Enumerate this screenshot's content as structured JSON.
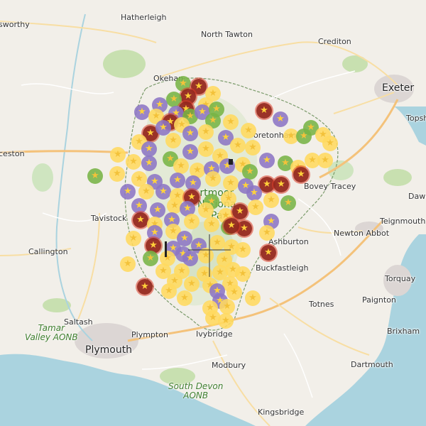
{
  "map": {
    "towns": [
      {
        "id": "holsworthy",
        "label": "sworthy",
        "size": "small"
      },
      {
        "id": "hatherleigh",
        "label": "Hatherleigh",
        "size": "small"
      },
      {
        "id": "north-tawton",
        "label": "North Tawton",
        "size": "small"
      },
      {
        "id": "crediton",
        "label": "Crediton",
        "size": "small"
      },
      {
        "id": "exeter",
        "label": "Exeter",
        "size": "big"
      },
      {
        "id": "topsham",
        "label": "Topsh",
        "size": "small"
      },
      {
        "id": "okehampton",
        "label": "Okehan",
        "size": "small"
      },
      {
        "id": "moretonhampstead",
        "label": "oretonham",
        "size": "small"
      },
      {
        "id": "launceston",
        "label": "ceston",
        "size": "small"
      },
      {
        "id": "bovey-tracey",
        "label": "Bovey Tracey",
        "size": "small"
      },
      {
        "id": "dawlish",
        "label": "Dawli",
        "size": "small"
      },
      {
        "id": "tavistock",
        "label": "Tavistock",
        "size": "small"
      },
      {
        "id": "teignmouth",
        "label": "Teignmouth",
        "size": "small"
      },
      {
        "id": "newton-abbot",
        "label": "Newton Abbot",
        "size": "small"
      },
      {
        "id": "ashburton",
        "label": "Ashburton",
        "size": "small"
      },
      {
        "id": "callington",
        "label": "Callington",
        "size": "small"
      },
      {
        "id": "buckfastleigh",
        "label": "Buckfastleigh",
        "size": "small"
      },
      {
        "id": "torquay",
        "label": "Torquay",
        "size": "small"
      },
      {
        "id": "totnes",
        "label": "Totnes",
        "size": "small"
      },
      {
        "id": "paignton",
        "label": "Paignton",
        "size": "small"
      },
      {
        "id": "saltash",
        "label": "Saltash",
        "size": "small"
      },
      {
        "id": "plympton",
        "label": "Plympton",
        "size": "small"
      },
      {
        "id": "ivybridge",
        "label": "Ivybridge",
        "size": "small"
      },
      {
        "id": "brixham",
        "label": "Brixham",
        "size": "small"
      },
      {
        "id": "plymouth",
        "label": "Plymouth",
        "size": "big"
      },
      {
        "id": "modbury",
        "label": "Modbury",
        "size": "small"
      },
      {
        "id": "dartmouth",
        "label": "Dartmouth",
        "size": "small"
      },
      {
        "id": "kingsbridge",
        "label": "Kingsbridge",
        "size": "small"
      }
    ],
    "parks": [
      {
        "id": "tamar-valley-aonb",
        "label": "Tamar\nValley AONB"
      },
      {
        "id": "south-devon-aonb",
        "label": "South Devon\nAONB"
      },
      {
        "id": "dartmoor-national-park",
        "label": "rtmoor\nNationa\nPa"
      }
    ],
    "marker_styles": {
      "yellow": {
        "fill": "#ffda5f",
        "star": "#f3c23a"
      },
      "purple": {
        "fill": "#8c75c4",
        "star": "#ffd23d"
      },
      "green": {
        "fill": "#78b446",
        "star": "#f3c23a"
      },
      "red": {
        "fill": "#962820",
        "star": "#ffcf3a"
      }
    },
    "marker_icon": "star-icon",
    "selection_icon": "crosshair-icon"
  }
}
